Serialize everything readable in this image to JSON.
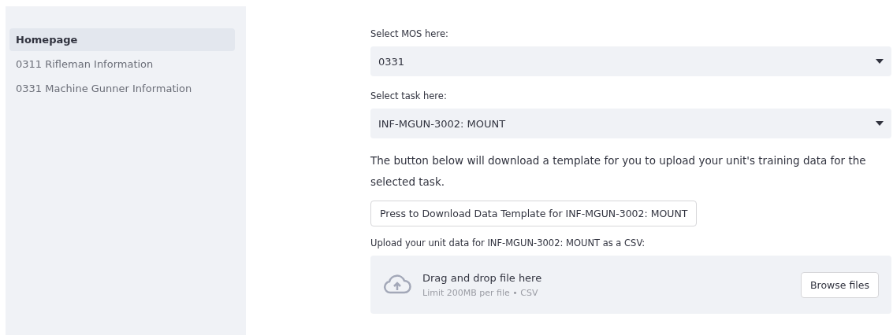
{
  "sidebar": {
    "items": [
      {
        "label": "Homepage",
        "selected": true
      },
      {
        "label": "0311 Rifleman Information",
        "selected": false
      },
      {
        "label": "0331 Machine Gunner Information",
        "selected": false
      }
    ]
  },
  "mos_select": {
    "label": "Select MOS here:",
    "value": "0331"
  },
  "task_select": {
    "label": "Select task here:",
    "value": "INF-MGUN-3002: MOUNT"
  },
  "description": "The button below will download a template for you to upload your unit's training data for the selected task.",
  "download_button": "Press to Download Data Template for INF-MGUN-3002: MOUNT",
  "uploader": {
    "label": "Upload your unit data for INF-MGUN-3002: MOUNT as a CSV:",
    "title": "Drag and drop file here",
    "hint": "Limit 200MB per file • CSV",
    "button": "Browse files"
  }
}
